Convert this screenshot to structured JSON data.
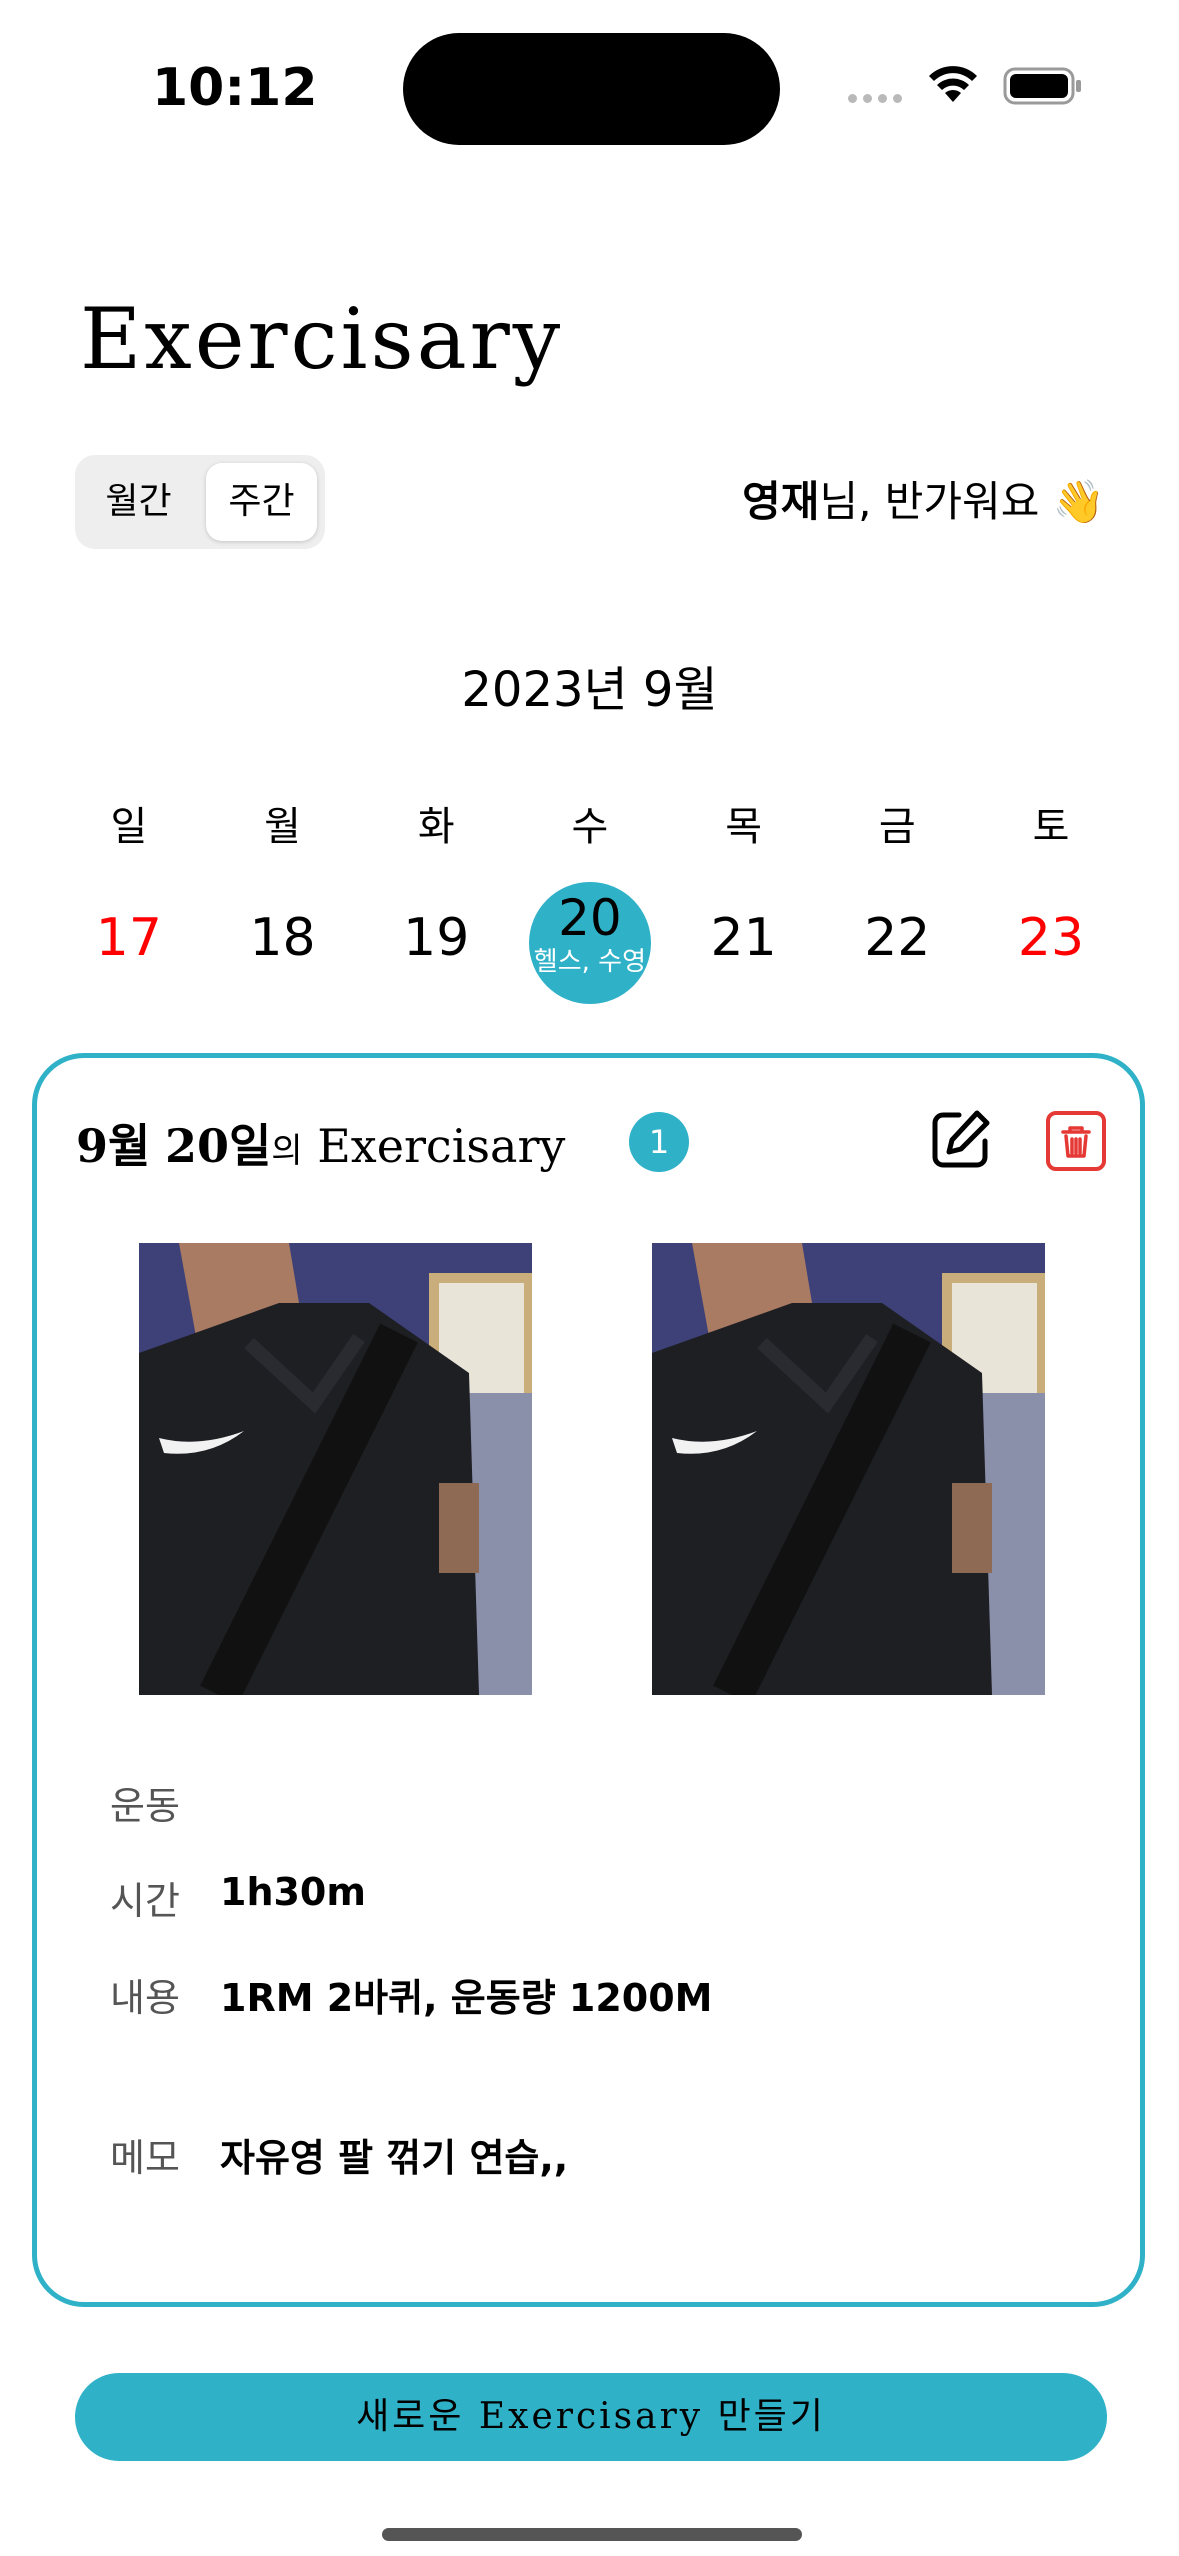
{
  "status_bar": {
    "time": "10:12"
  },
  "app_title": "Exercisary",
  "view_toggle": {
    "monthly": "월간",
    "weekly": "주간",
    "selected": "weekly"
  },
  "greeting": {
    "name": "영재",
    "suffix": "님, 반가워요 👋"
  },
  "calendar": {
    "month_label": "2023년 9월",
    "weekdays": [
      "일",
      "월",
      "화",
      "수",
      "목",
      "금",
      "토"
    ],
    "days": [
      "17",
      "18",
      "19",
      "20",
      "21",
      "22",
      "23"
    ],
    "selected_day": "20",
    "selected_day_tags": "헬스, 수영"
  },
  "entry_card": {
    "title_month": "9월",
    "title_day": "20일",
    "title_possessive": "의",
    "title_app": "Exercisary",
    "count": "1",
    "exercise_label": "운동",
    "exercise_value": "",
    "time_label": "시간",
    "time_value": "1h30m",
    "content_label": "내용",
    "content_value": "1RM 2바퀴, 운동량 1200M",
    "memo_label": "메모",
    "memo_value": "자유영 팔 꺾기 연습,,"
  },
  "create_button": "새로운 Exercisary 만들기",
  "colors": {
    "accent": "#2fb1c8",
    "weekend": "#ff0000",
    "delete": "#e53935"
  },
  "icons": [
    "wifi-icon",
    "battery-icon",
    "edit-icon",
    "trash-icon"
  ]
}
